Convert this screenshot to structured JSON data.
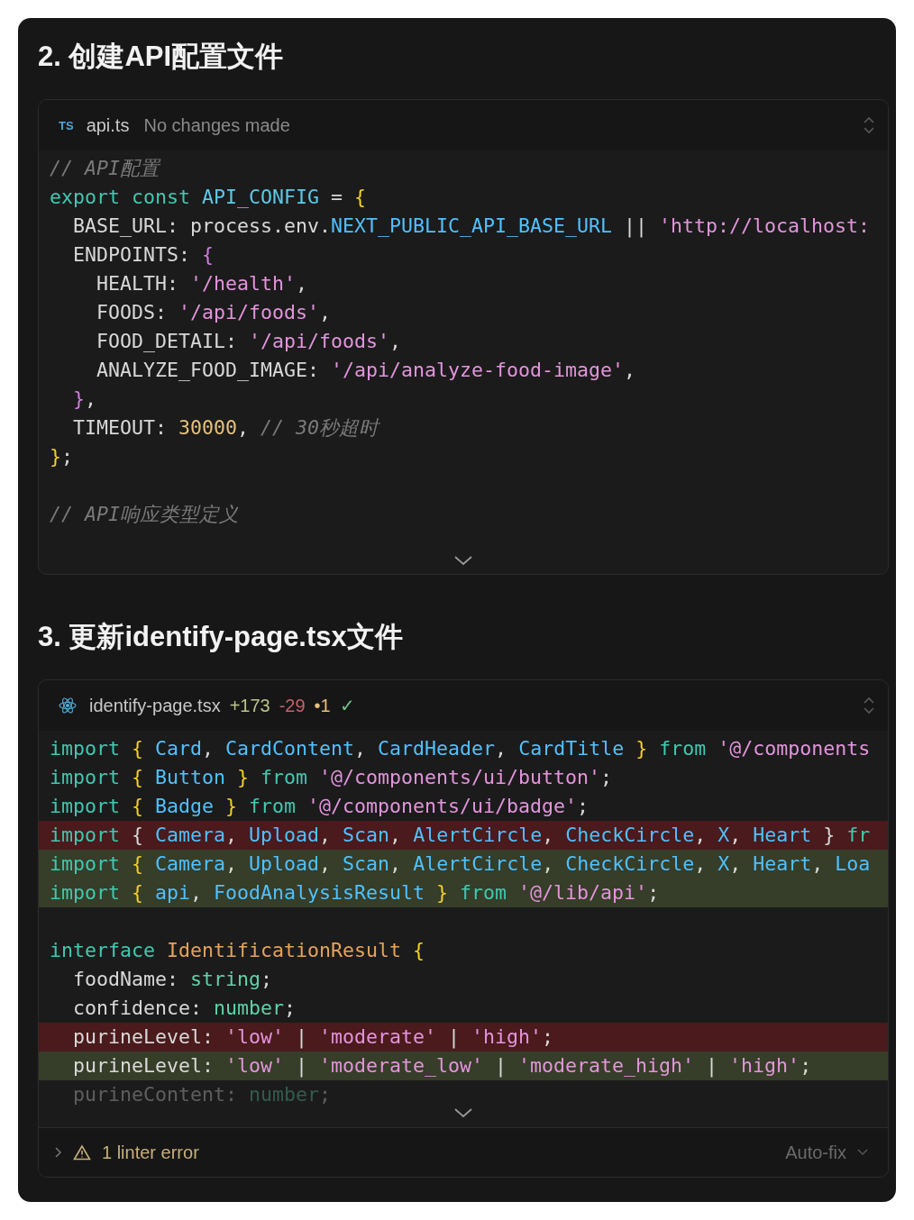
{
  "sections": [
    {
      "heading": "2. 创建API配置文件",
      "file": {
        "kind": "ts",
        "badge": "TS",
        "name": "api.ts",
        "status": [
          {
            "text": "No changes made",
            "kind": "muted"
          }
        ]
      },
      "lines": [
        {
          "kind": "normal",
          "tokens": [
            {
              "text": "// API配置",
              "kind": "comment"
            }
          ]
        },
        {
          "kind": "normal",
          "tokens": [
            {
              "text": "export const ",
              "kind": "kw"
            },
            {
              "text": "API_CONFIG",
              "kind": "const"
            },
            {
              "text": " = ",
              "kind": "plain"
            },
            {
              "text": "{",
              "kind": "brace"
            }
          ]
        },
        {
          "kind": "normal",
          "tokens": [
            {
              "text": "  BASE_URL: process.env.",
              "kind": "plain"
            },
            {
              "text": "NEXT_PUBLIC_API_BASE_URL",
              "kind": "prop"
            },
            {
              "text": " || ",
              "kind": "plain"
            },
            {
              "text": "'http://localhost:",
              "kind": "str"
            }
          ]
        },
        {
          "kind": "normal",
          "tokens": [
            {
              "text": "  ENDPOINTS: ",
              "kind": "plain"
            },
            {
              "text": "{",
              "kind": "brace2"
            }
          ]
        },
        {
          "kind": "normal",
          "tokens": [
            {
              "text": "    HEALTH: ",
              "kind": "plain"
            },
            {
              "text": "'/health'",
              "kind": "str"
            },
            {
              "text": ",",
              "kind": "plain"
            }
          ]
        },
        {
          "kind": "normal",
          "tokens": [
            {
              "text": "    FOODS: ",
              "kind": "plain"
            },
            {
              "text": "'/api/foods'",
              "kind": "str"
            },
            {
              "text": ",",
              "kind": "plain"
            }
          ]
        },
        {
          "kind": "normal",
          "tokens": [
            {
              "text": "    FOOD_DETAIL: ",
              "kind": "plain"
            },
            {
              "text": "'/api/foods'",
              "kind": "str"
            },
            {
              "text": ",",
              "kind": "plain"
            }
          ]
        },
        {
          "kind": "normal",
          "tokens": [
            {
              "text": "    ANALYZE_FOOD_IMAGE: ",
              "kind": "plain"
            },
            {
              "text": "'/api/analyze-food-image'",
              "kind": "str"
            },
            {
              "text": ",",
              "kind": "plain"
            }
          ]
        },
        {
          "kind": "normal",
          "tokens": [
            {
              "text": "  }",
              "kind": "brace2"
            },
            {
              "text": ",",
              "kind": "plain"
            }
          ]
        },
        {
          "kind": "normal",
          "tokens": [
            {
              "text": "  TIMEOUT: ",
              "kind": "plain"
            },
            {
              "text": "30000",
              "kind": "num"
            },
            {
              "text": ", ",
              "kind": "plain"
            },
            {
              "text": "// 30秒超时",
              "kind": "comment"
            }
          ]
        },
        {
          "kind": "normal",
          "tokens": [
            {
              "text": "}",
              "kind": "brace"
            },
            {
              "text": ";",
              "kind": "plain"
            }
          ]
        },
        {
          "kind": "blank"
        },
        {
          "kind": "normal",
          "tokens": [
            {
              "text": "// API响应类型定义",
              "kind": "comment"
            }
          ]
        }
      ]
    },
    {
      "heading": "3. 更新identify-page.tsx文件",
      "file": {
        "kind": "react",
        "name": "identify-page.tsx",
        "status": [
          {
            "text": "+173",
            "kind": "add"
          },
          {
            "text": "-29",
            "kind": "del"
          },
          {
            "text": "•1",
            "kind": "warn"
          },
          {
            "text": "✓",
            "kind": "ok"
          }
        ]
      },
      "lines": [
        {
          "kind": "normal",
          "tokens": [
            {
              "text": "import ",
              "kind": "kw"
            },
            {
              "text": "{ ",
              "kind": "brace"
            },
            {
              "text": "Card",
              "kind": "prop"
            },
            {
              "text": ", ",
              "kind": "plain"
            },
            {
              "text": "CardContent",
              "kind": "prop"
            },
            {
              "text": ", ",
              "kind": "plain"
            },
            {
              "text": "CardHeader",
              "kind": "prop"
            },
            {
              "text": ", ",
              "kind": "plain"
            },
            {
              "text": "CardTitle",
              "kind": "prop"
            },
            {
              "text": " }",
              "kind": "brace"
            },
            {
              "text": " from ",
              "kind": "kw"
            },
            {
              "text": "'@/components",
              "kind": "str"
            }
          ]
        },
        {
          "kind": "normal",
          "tokens": [
            {
              "text": "import ",
              "kind": "kw"
            },
            {
              "text": "{ ",
              "kind": "brace"
            },
            {
              "text": "Button",
              "kind": "prop"
            },
            {
              "text": " }",
              "kind": "brace"
            },
            {
              "text": " from ",
              "kind": "kw"
            },
            {
              "text": "'@/components/ui/button'",
              "kind": "str"
            },
            {
              "text": ";",
              "kind": "plain"
            }
          ]
        },
        {
          "kind": "normal",
          "tokens": [
            {
              "text": "import ",
              "kind": "kw"
            },
            {
              "text": "{ ",
              "kind": "brace"
            },
            {
              "text": "Badge",
              "kind": "prop"
            },
            {
              "text": " }",
              "kind": "brace"
            },
            {
              "text": " from ",
              "kind": "kw"
            },
            {
              "text": "'@/components/ui/badge'",
              "kind": "str"
            },
            {
              "text": ";",
              "kind": "plain"
            }
          ]
        },
        {
          "kind": "removed",
          "tokens": [
            {
              "text": "import ",
              "kind": "kw"
            },
            {
              "text": "{ ",
              "kind": "plain"
            },
            {
              "text": "Camera",
              "kind": "prop"
            },
            {
              "text": ", ",
              "kind": "plain"
            },
            {
              "text": "Upload",
              "kind": "prop"
            },
            {
              "text": ", ",
              "kind": "plain"
            },
            {
              "text": "Scan",
              "kind": "prop"
            },
            {
              "text": ", ",
              "kind": "plain"
            },
            {
              "text": "AlertCircle",
              "kind": "prop"
            },
            {
              "text": ", ",
              "kind": "plain"
            },
            {
              "text": "CheckCircle",
              "kind": "prop"
            },
            {
              "text": ", ",
              "kind": "plain"
            },
            {
              "text": "X",
              "kind": "prop"
            },
            {
              "text": ", ",
              "kind": "plain"
            },
            {
              "text": "Heart",
              "kind": "prop"
            },
            {
              "text": " } ",
              "kind": "plain"
            },
            {
              "text": "fr",
              "kind": "kw"
            }
          ]
        },
        {
          "kind": "added",
          "tokens": [
            {
              "text": "import ",
              "kind": "kw"
            },
            {
              "text": "{ ",
              "kind": "brace"
            },
            {
              "text": "Camera",
              "kind": "prop"
            },
            {
              "text": ", ",
              "kind": "plain"
            },
            {
              "text": "Upload",
              "kind": "prop"
            },
            {
              "text": ", ",
              "kind": "plain"
            },
            {
              "text": "Scan",
              "kind": "prop"
            },
            {
              "text": ", ",
              "kind": "plain"
            },
            {
              "text": "AlertCircle",
              "kind": "prop"
            },
            {
              "text": ", ",
              "kind": "plain"
            },
            {
              "text": "CheckCircle",
              "kind": "prop"
            },
            {
              "text": ", ",
              "kind": "plain"
            },
            {
              "text": "X",
              "kind": "prop"
            },
            {
              "text": ", ",
              "kind": "plain"
            },
            {
              "text": "Heart",
              "kind": "prop"
            },
            {
              "text": ", ",
              "kind": "plain"
            },
            {
              "text": "Loa",
              "kind": "prop"
            }
          ]
        },
        {
          "kind": "added",
          "tokens": [
            {
              "text": "import ",
              "kind": "kw"
            },
            {
              "text": "{ ",
              "kind": "brace"
            },
            {
              "text": "api",
              "kind": "prop"
            },
            {
              "text": ", ",
              "kind": "plain"
            },
            {
              "text": "FoodAnalysisResult",
              "kind": "prop"
            },
            {
              "text": " }",
              "kind": "brace"
            },
            {
              "text": " from ",
              "kind": "kw"
            },
            {
              "text": "'@/lib/api'",
              "kind": "str"
            },
            {
              "text": ";",
              "kind": "plain"
            }
          ]
        },
        {
          "kind": "blank"
        },
        {
          "kind": "normal",
          "tokens": [
            {
              "text": "interface ",
              "kind": "kw"
            },
            {
              "text": "IdentificationResult",
              "kind": "type"
            },
            {
              "text": " {",
              "kind": "brace"
            }
          ]
        },
        {
          "kind": "normal",
          "tokens": [
            {
              "text": "  foodName: ",
              "kind": "plain"
            },
            {
              "text": "string",
              "kind": "tname"
            },
            {
              "text": ";",
              "kind": "plain"
            }
          ]
        },
        {
          "kind": "normal",
          "tokens": [
            {
              "text": "  confidence: ",
              "kind": "plain"
            },
            {
              "text": "number",
              "kind": "tname"
            },
            {
              "text": ";",
              "kind": "plain"
            }
          ]
        },
        {
          "kind": "removed",
          "tokens": [
            {
              "text": "  purineLevel: ",
              "kind": "plain"
            },
            {
              "text": "'low'",
              "kind": "str"
            },
            {
              "text": " | ",
              "kind": "plain"
            },
            {
              "text": "'moderate'",
              "kind": "str"
            },
            {
              "text": " | ",
              "kind": "plain"
            },
            {
              "text": "'high'",
              "kind": "str"
            },
            {
              "text": ";",
              "kind": "plain"
            }
          ]
        },
        {
          "kind": "added",
          "tokens": [
            {
              "text": "  purineLevel: ",
              "kind": "plain"
            },
            {
              "text": "'low'",
              "kind": "str"
            },
            {
              "text": " | ",
              "kind": "plain"
            },
            {
              "text": "'moderate_low'",
              "kind": "str"
            },
            {
              "text": " | ",
              "kind": "plain"
            },
            {
              "text": "'moderate_high'",
              "kind": "str"
            },
            {
              "text": " | ",
              "kind": "plain"
            },
            {
              "text": "'high'",
              "kind": "str"
            },
            {
              "text": ";",
              "kind": "plain"
            }
          ]
        },
        {
          "kind": "faded",
          "tokens": [
            {
              "text": "  purineContent: ",
              "kind": "plain"
            },
            {
              "text": "number",
              "kind": "tname"
            },
            {
              "text": ";",
              "kind": "plain"
            }
          ]
        }
      ],
      "footer": {
        "message": "1 linter error",
        "action": "Auto-fix"
      }
    }
  ]
}
